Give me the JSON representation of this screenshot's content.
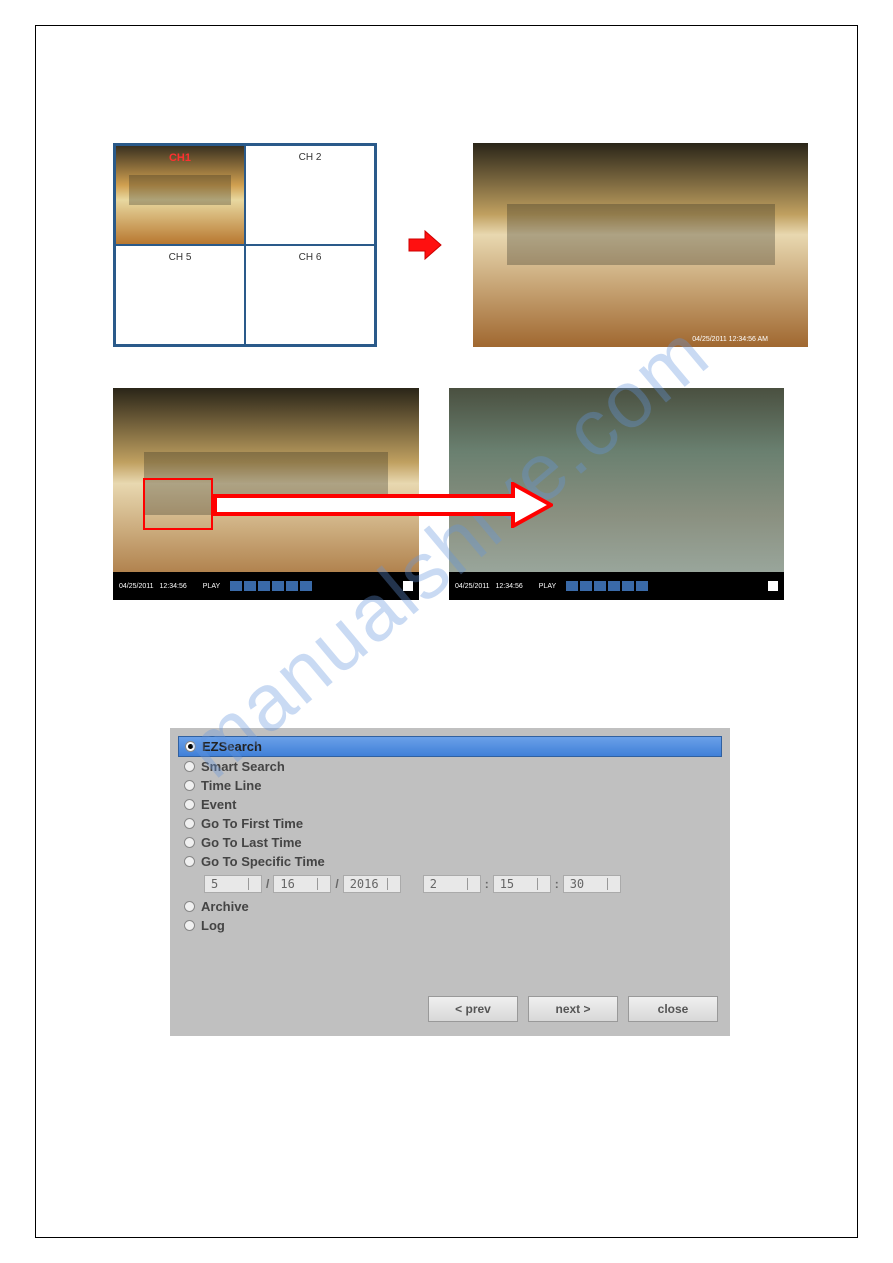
{
  "grid": {
    "ch1": "CH1",
    "ch2": "CH 2",
    "ch5": "CH 5",
    "ch6": "CH 6"
  },
  "playback": {
    "date1": "04/25/2011",
    "time1": "12:34:56",
    "play": "PLAY",
    "date2": "04/25/2011",
    "time2": "12:34:56"
  },
  "large_timestamp": "04/25/2011 12:34:56  AM",
  "watermark": "manualshive.com",
  "dialog": {
    "options": {
      "ezsearch": "EZSearch",
      "smart": "Smart Search",
      "timeline": "Time Line",
      "event": "Event",
      "first": "Go To First Time",
      "last": "Go To Last Time",
      "specific": "Go To Specific Time",
      "archive": "Archive",
      "log": "Log"
    },
    "date": {
      "month": "5",
      "day": "16",
      "year": "2016",
      "hour": "2",
      "minute": "15",
      "second": "30"
    },
    "buttons": {
      "prev": "< prev",
      "next": "next >",
      "close": "close"
    }
  }
}
